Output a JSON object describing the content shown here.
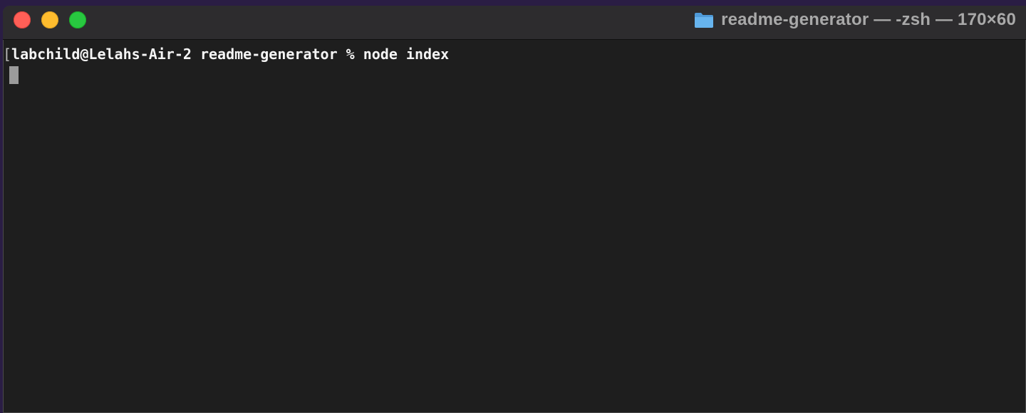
{
  "window": {
    "title": "readme-generator — -zsh — 170×60",
    "colors": {
      "close": "#ff5f57",
      "minimize": "#febc2e",
      "zoom": "#28c840",
      "folder": "#5aa7e6",
      "background": "#1e1e1e"
    },
    "icon": "folder-icon"
  },
  "terminal": {
    "lines": [
      {
        "bracket": "[",
        "text": "labchild@Lelahs-Air-2 readme-generator % node index"
      }
    ]
  }
}
